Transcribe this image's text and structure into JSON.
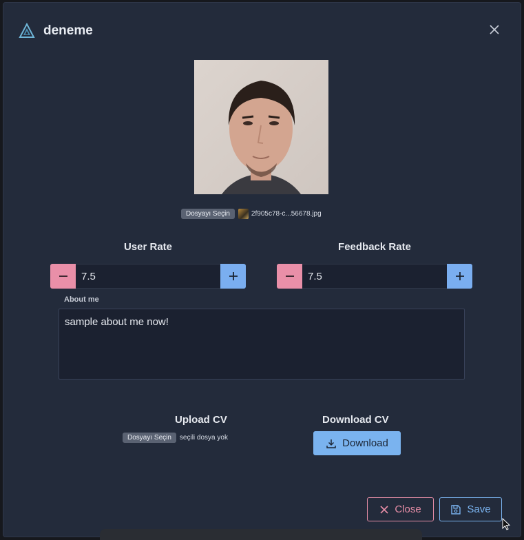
{
  "dialog": {
    "title": "deneme",
    "logo_icon": "triangle-logo",
    "close_icon": "close-icon"
  },
  "photo": {
    "file_button": "Dosyayı Seçin",
    "file_name": "2f905c78-c...56678.jpg"
  },
  "user_rate": {
    "label": "User Rate",
    "value": "7.5"
  },
  "feedback_rate": {
    "label": "Feedback Rate",
    "value": "7.5"
  },
  "about": {
    "label": "About me",
    "value": "sample about me now!"
  },
  "upload_cv": {
    "label": "Upload CV",
    "file_button": "Dosyayı Seçin",
    "file_status": "seçili dosya yok"
  },
  "download_cv": {
    "label": "Download CV",
    "button": "Download"
  },
  "footer": {
    "close_label": "Close",
    "save_label": "Save"
  },
  "colors": {
    "dialog_bg": "#232b3b",
    "danger": "#e98fa8",
    "primary": "#7ab3ef"
  }
}
